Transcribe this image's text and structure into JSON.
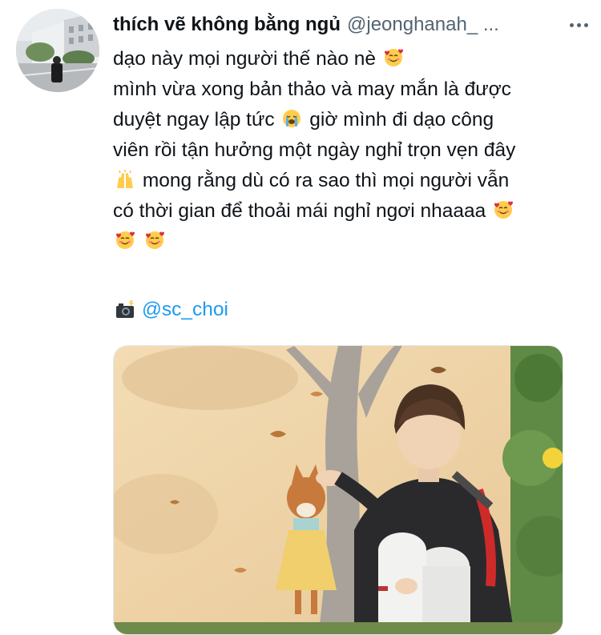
{
  "tweet": {
    "display_name": "thích vẽ không bằng ngủ",
    "handle": "@jeonghanah_ ...",
    "lines": {
      "l1": "dạo này mọi người thế nào nè",
      "l2": "mình vừa xong bản thảo và may mắn là được",
      "l3a": "duyệt ngay lập tức",
      "l3b": "giờ mình đi dạo công",
      "l4": "viên rồi tận hưởng một ngày nghỉ trọn vẹn đây",
      "l5": "mong rằng dù có ra sao thì mọi người vẫn",
      "l6": "có thời gian để thoải mái nghỉ ngơi nhaaaa"
    },
    "credit_mention": "@sc_choi"
  },
  "icons": {
    "more": "more-horizontal-icon",
    "smiling_hearts": "smiling-face-with-hearts-emoji",
    "loudly_crying": "loudly-crying-face-emoji",
    "raising_hands": "raising-hands-emoji",
    "camera_flash": "camera-with-flash-emoji"
  },
  "colors": {
    "text": "#0f1419",
    "secondary": "#536471",
    "link": "#1d9bf0"
  }
}
